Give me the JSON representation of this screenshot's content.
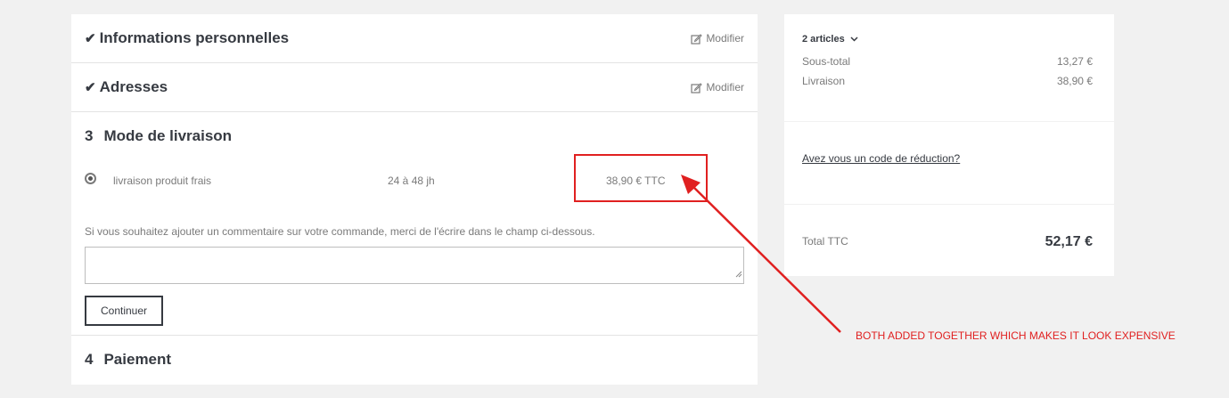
{
  "checkout": {
    "steps": [
      {
        "title": "Informations personnelles",
        "edit_label": "Modifier"
      },
      {
        "title": "Adresses",
        "edit_label": "Modifier"
      },
      {
        "number": "3",
        "title": "Mode de livraison"
      },
      {
        "number": "4",
        "title": "Paiement"
      }
    ],
    "carrier": {
      "name": "livraison produit frais",
      "delay": "24 à 48 jh",
      "price": "38,90 € TTC",
      "selected": true
    },
    "comment": {
      "label": "Si vous souhaitez ajouter un commentaire sur votre commande, merci de l'écrire dans le champ ci-dessous.",
      "value": ""
    },
    "continue_label": "Continuer"
  },
  "summary": {
    "articles_label": "2 articles",
    "lines": [
      {
        "label": "Sous-total",
        "value": "13,27 €"
      },
      {
        "label": "Livraison",
        "value": "38,90 €"
      }
    ],
    "promo_link": "Avez vous un code de réduction?",
    "total_label": "Total TTC",
    "total_value": "52,17 €"
  },
  "annotation": {
    "text": "BOTH ADDED TOGETHER WHICH MAKES IT LOOK EXPENSIVE",
    "color": "#e02020"
  },
  "icons": [
    "check-icon",
    "edit-icon",
    "chevron-down-icon",
    "radio-selected-icon",
    "resize-grip-icon"
  ]
}
